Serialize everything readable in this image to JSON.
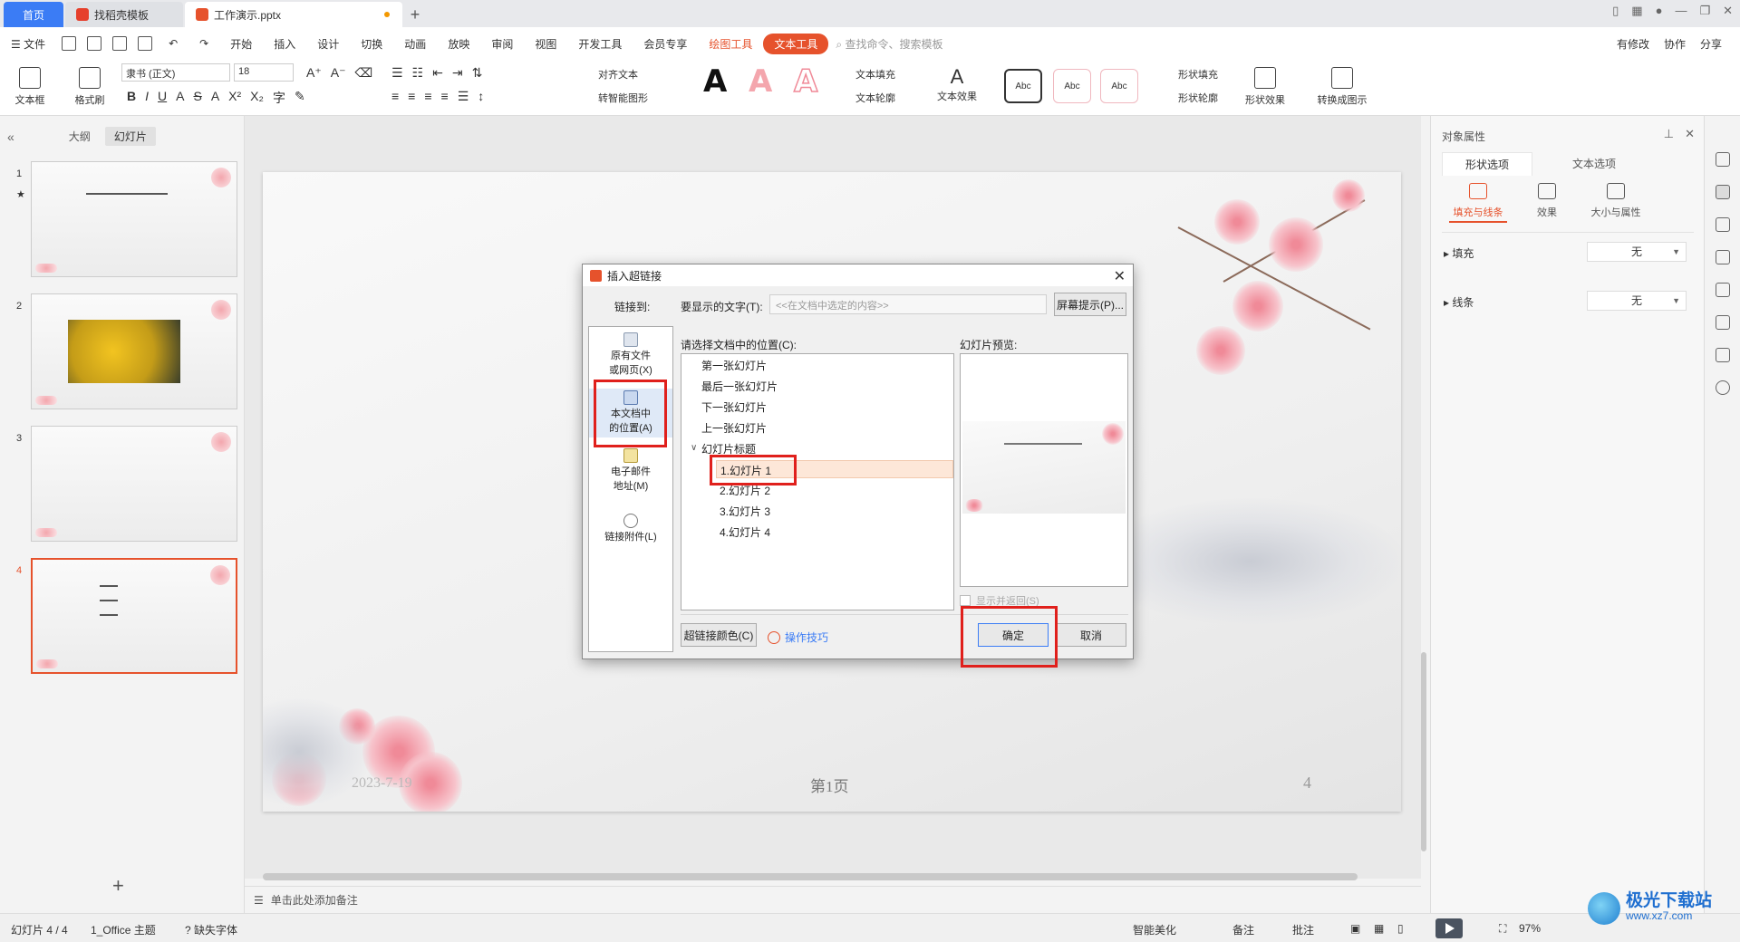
{
  "titlebar": {
    "tabs": [
      {
        "label": "首页"
      },
      {
        "label": "找稻壳模板"
      },
      {
        "label": "工作演示.pptx"
      }
    ],
    "new_tab_symbol": "+"
  },
  "menubar": {
    "file": "文件",
    "items": [
      "开始",
      "插入",
      "设计",
      "切换",
      "动画",
      "放映",
      "审阅",
      "视图",
      "开发工具",
      "会员专享"
    ],
    "context_tabs": [
      "绘图工具",
      "文本工具"
    ],
    "search_placeholder": "查找命令、搜索模板",
    "right": [
      "有修改",
      "协作",
      "分享"
    ]
  },
  "ribbon": {
    "textbox": "文本框",
    "format_painter": "格式刷",
    "font_name": "隶书 (正文)",
    "font_size": "18",
    "align_text": "对齐文本",
    "smartart": "转智能图形",
    "text_fill": "文本填充",
    "text_outline": "文本轮廓",
    "text_effect": "文本效果",
    "shape_fill": "形状填充",
    "shape_outline": "形状轮廓",
    "shape_effect": "形状效果",
    "convert_image": "转换成图示",
    "style_letter": "A",
    "abc_label": "Abc"
  },
  "left_panel": {
    "tabs": [
      "大纲",
      "幻灯片"
    ],
    "slide_numbers": [
      "1",
      "2",
      "3",
      "4"
    ],
    "add_symbol": "+"
  },
  "slide": {
    "date": "2023-7-19",
    "page_label": "第1页",
    "number": "4"
  },
  "notes_placeholder": "单击此处添加备注",
  "right_panel": {
    "title": "对象属性",
    "tabs": [
      "形状选项",
      "文本选项"
    ],
    "subtabs": [
      "填充与线条",
      "效果",
      "大小与属性"
    ],
    "rows": [
      {
        "label": "填充",
        "value": "无"
      },
      {
        "label": "线条",
        "value": "无"
      }
    ]
  },
  "statusbar": {
    "slide_count": "幻灯片 4 / 4",
    "theme": "1_Office 主题",
    "missing_font": "缺失字体",
    "beautify": "智能美化",
    "notes": "备注",
    "comments": "批注",
    "zoom": "97%"
  },
  "dialog": {
    "title": "插入超链接",
    "link_to_label": "链接到:",
    "display_text_label": "要显示的文字(T):",
    "display_text_value": "<<在文档中选定的内容>>",
    "screentip_button": "屏幕提示(P)...",
    "link_options": [
      {
        "line1": "原有文件",
        "line2": "或网页(X)"
      },
      {
        "line1": "本文档中",
        "line2": "的位置(A)"
      },
      {
        "line1": "电子邮件",
        "line2": "地址(M)"
      },
      {
        "line1": "链接附件(L)",
        "line2": ""
      }
    ],
    "location_label": "请选择文档中的位置(C):",
    "tree": [
      "第一张幻灯片",
      "最后一张幻灯片",
      "下一张幻灯片",
      "上一张幻灯片"
    ],
    "tree_group": "幻灯片标题",
    "slides": [
      "1.幻灯片 1",
      "2.幻灯片 2",
      "3.幻灯片 3",
      "4.幻灯片 4"
    ],
    "preview_label": "幻灯片预览:",
    "show_return": "显示并返回(S)",
    "link_color_button": "超链接颜色(C)",
    "help_link": "操作技巧",
    "ok": "确定",
    "cancel": "取消"
  },
  "watermark": {
    "line1": "极光下载站",
    "line2": "www.xz7.com"
  },
  "colors": {
    "accent": "#e6522c",
    "home_tab": "#3b7cf5",
    "highlight_box": "#e0201c"
  }
}
